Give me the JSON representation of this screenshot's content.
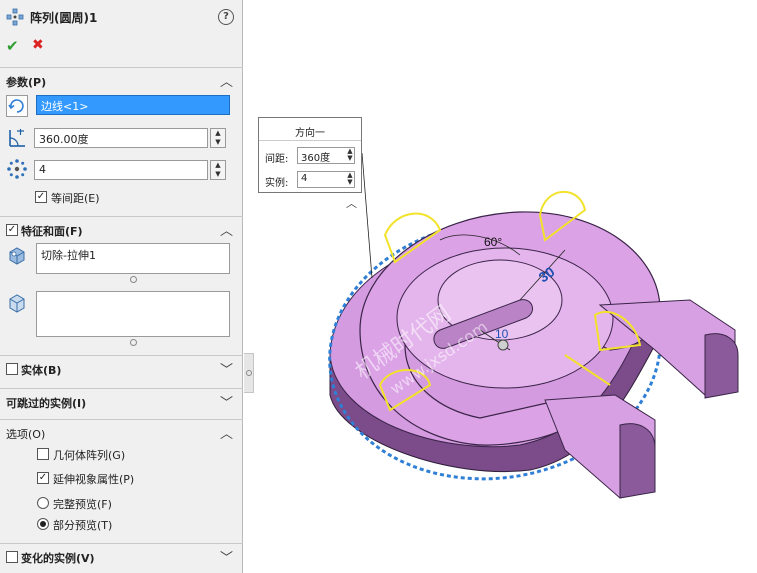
{
  "feature": {
    "title": "阵列(圆周)1",
    "ok_icon": "check-icon",
    "cancel_icon": "x-icon"
  },
  "parameters": {
    "header": "参数(P)",
    "axis_value": "边线<1>",
    "angle_value": "360.00度",
    "instances_value": "4",
    "equal_spacing_label": "等间距(E)",
    "equal_spacing_checked": true
  },
  "features_faces": {
    "header": "特征和面(F)",
    "checked": true,
    "features_list": [
      "切除-拉伸1"
    ],
    "faces_list": []
  },
  "bodies": {
    "header": "实体(B)",
    "checked": false
  },
  "skip_instances": {
    "header": "可跳过的实例(I)"
  },
  "options": {
    "header": "选项(O)",
    "geometry_pattern_label": "几何体阵列(G)",
    "geometry_pattern_checked": false,
    "propagate_visual_label": "延伸视象属性(P)",
    "propagate_visual_checked": true,
    "full_preview_label": "完整预览(F)",
    "partial_preview_label": "部分预览(T)",
    "preview_mode": "partial"
  },
  "varying_instances": {
    "header": "变化的实例(V)",
    "checked": false
  },
  "callout": {
    "title": "方向一",
    "spacing_label": "间距:",
    "spacing_value": "360度",
    "instances_label": "实例:",
    "instances_value": "4"
  },
  "dimensions": {
    "angle_dim": "60°",
    "linear_dim": "30",
    "small_dim": "10"
  },
  "watermark": {
    "line1": "机械时代网",
    "line2": "www.jxsd.com"
  },
  "colors": {
    "selected_field": "#3399ff",
    "part_face": "#d58ce0",
    "pattern_axis": "#2f7fd6",
    "preview": "#f2e22a"
  }
}
